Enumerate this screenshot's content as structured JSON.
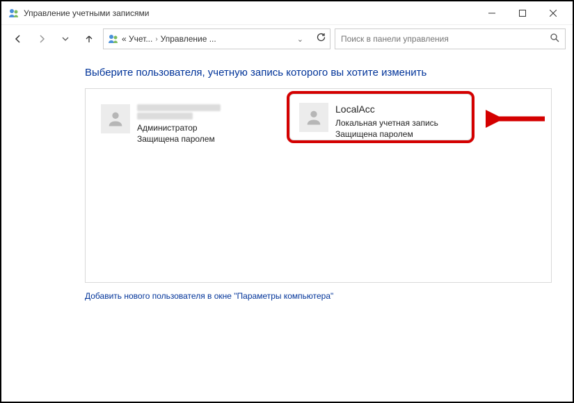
{
  "window": {
    "title": "Управление учетными записями"
  },
  "breadcrumb": {
    "segment1": "« Учет...",
    "segment2": "Управление ..."
  },
  "search": {
    "placeholder": "Поиск в панели управления"
  },
  "heading": "Выберите пользователя, учетную запись которого вы хотите изменить",
  "users": {
    "admin": {
      "role": "Администратор",
      "protected": "Защищена паролем"
    },
    "local": {
      "name": "LocalAcc",
      "type": "Локальная учетная запись",
      "protected": "Защищена паролем"
    }
  },
  "add_user_link": "Добавить нового пользователя в окне \"Параметры компьютера\""
}
